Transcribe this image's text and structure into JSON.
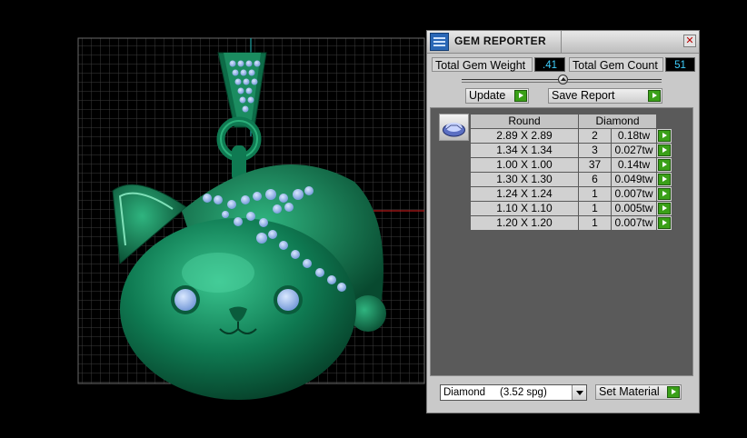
{
  "panel": {
    "title": "GEM REPORTER",
    "close_glyph": "✕",
    "total_gem_weight_label": "Total Gem Weight",
    "total_gem_weight_value": ".41",
    "total_gem_count_label": "Total Gem Count",
    "total_gem_count_value": "51",
    "update_label": "Update",
    "save_report_label": "Save Report",
    "table": {
      "headers": [
        "Round",
        "Diamond"
      ],
      "rows": [
        {
          "size": "2.89 X 2.89",
          "count": "2",
          "weight": "0.18tw"
        },
        {
          "size": "1.34 X 1.34",
          "count": "3",
          "weight": "0.027tw"
        },
        {
          "size": "1.00 X 1.00",
          "count": "37",
          "weight": "0.14tw"
        },
        {
          "size": "1.30 X 1.30",
          "count": "6",
          "weight": "0.049tw"
        },
        {
          "size": "1.24 X 1.24",
          "count": "1",
          "weight": "0.007tw"
        },
        {
          "size": "1.10 X 1.10",
          "count": "1",
          "weight": "0.005tw"
        },
        {
          "size": "1.20 X 1.20",
          "count": "1",
          "weight": "0.007tw"
        }
      ]
    },
    "material_select": "Diamond     (3.52 spg)",
    "set_material_label": "Set Material"
  },
  "colors": {
    "model_green": "#1f9a6a",
    "gem_blue": "#8fb7ee",
    "value_cyan": "#3fd0ff",
    "go_green": "#3aa018"
  }
}
